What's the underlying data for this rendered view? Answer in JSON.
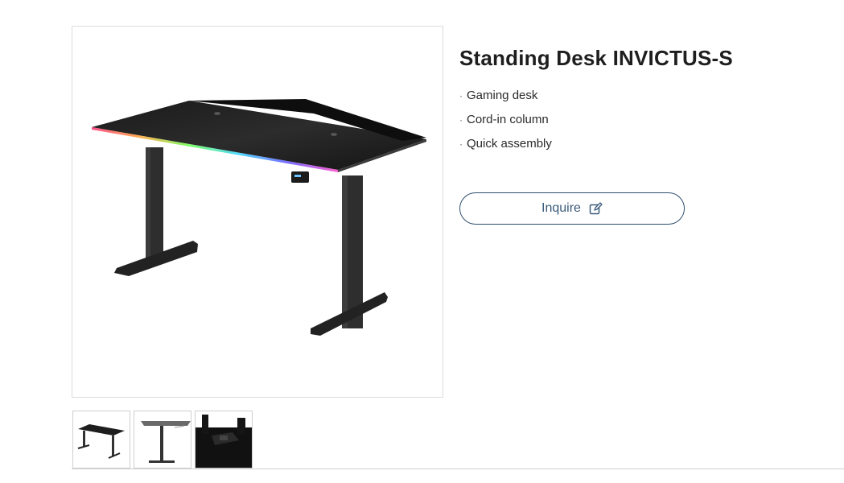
{
  "product": {
    "title": "Standing Desk INVICTUS-S",
    "features": [
      {
        "bullet": "·",
        "label": "Gaming desk"
      },
      {
        "bullet": "·",
        "label": "Cord-in column"
      },
      {
        "bullet": "·",
        "label": "Quick assembly"
      }
    ],
    "inquire_label": "Inquire",
    "inquire_icon": "edit-icon"
  },
  "gallery": {
    "main_image": "standing-desk-product-photo",
    "thumbnails": [
      {
        "name": "thumbnail-desk-angle-view"
      },
      {
        "name": "thumbnail-desk-side-view"
      },
      {
        "name": "thumbnail-desk-control-panel-closeup"
      }
    ]
  },
  "colors": {
    "title": "#1e1e1e",
    "button_border": "#2f4f6f",
    "button_text": "#3a5a7a",
    "frame_border": "#dcdcdc"
  }
}
